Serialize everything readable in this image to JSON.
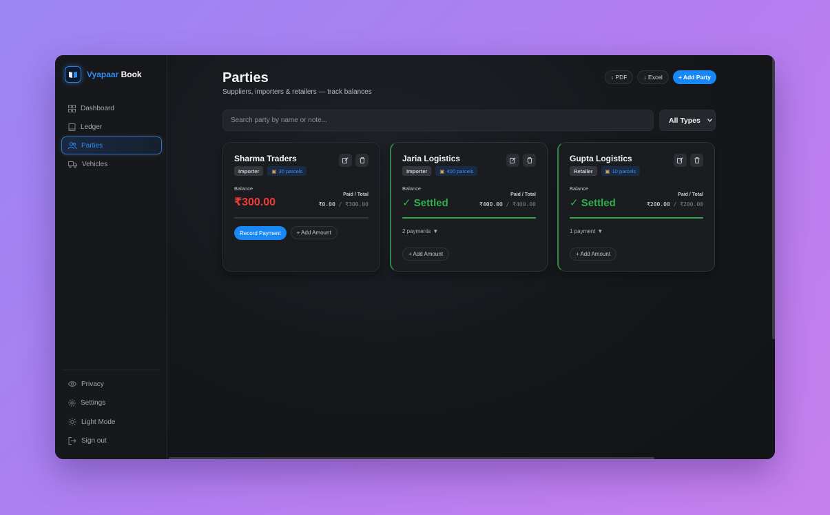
{
  "app": {
    "brand_first": "Vyapaar",
    "brand_second": "Book"
  },
  "sidebar": {
    "items": [
      {
        "label": "Dashboard",
        "icon": "grid-icon",
        "active": false
      },
      {
        "label": "Ledger",
        "icon": "book-icon",
        "active": false
      },
      {
        "label": "Parties",
        "icon": "users-icon",
        "active": true
      },
      {
        "label": "Vehicles",
        "icon": "truck-icon",
        "active": false
      }
    ],
    "bottom_items": [
      {
        "label": "Privacy",
        "icon": "eye-icon"
      },
      {
        "label": "Settings",
        "icon": "gear-icon"
      },
      {
        "label": "Light Mode",
        "icon": "sun-icon"
      },
      {
        "label": "Sign out",
        "icon": "sign-out-icon"
      }
    ]
  },
  "header": {
    "title": "Parties",
    "subtitle": "Suppliers, importers & retailers — track balances",
    "pdf_label": "↓ PDF",
    "excel_label": "↓ Excel",
    "add_party_label": "+ Add Party"
  },
  "search": {
    "placeholder": "Search party by name or note..."
  },
  "filter": {
    "selected": "All Types"
  },
  "cards": [
    {
      "name": "Sharma Traders",
      "type": "Importer",
      "parcels": "30 parcels",
      "balance_label": "Balance",
      "balance": "₹300.00",
      "paid_total_label": "Paid / Total",
      "paid": "₹0.00",
      "total": "₹300.00",
      "progress": 0,
      "record_payment_label": "Record Payment",
      "add_amount_label": "+ Add Amount"
    },
    {
      "name": "Jaria Logistics",
      "type": "Importer",
      "parcels": "400 parcels",
      "balance_label": "Balance",
      "balance": "✓ Settled",
      "paid_total_label": "Paid / Total",
      "paid": "₹400.00",
      "total": "₹400.00",
      "progress": 1,
      "payments": "2 payments",
      "add_amount_label": "+ Add Amount"
    },
    {
      "name": "Gupta Logistics",
      "type": "Retailer",
      "parcels": "10 parcels",
      "balance_label": "Balance",
      "balance": "✓ Settled",
      "paid_total_label": "Paid / Total",
      "paid": "₹200.00",
      "total": "₹200.00",
      "progress": 1,
      "payments": "1 payment",
      "add_amount_label": "+ Add Amount"
    }
  ],
  "colors": {
    "accent": "#1788f5",
    "danger": "#ef3b35",
    "success": "#31b04d"
  }
}
